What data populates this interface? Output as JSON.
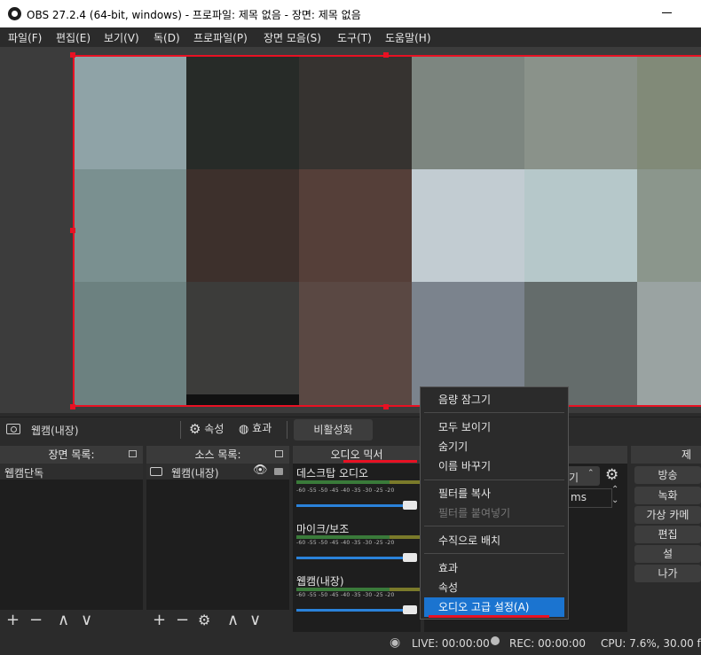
{
  "window": {
    "title": "OBS 27.2.4 (64-bit, windows) - 프로파일: 제목 없음 - 장면: 제목 없음"
  },
  "menubar": [
    {
      "label": "파일(F)",
      "name": "menu-file"
    },
    {
      "label": "편집(E)",
      "name": "menu-edit"
    },
    {
      "label": "보기(V)",
      "name": "menu-view"
    },
    {
      "label": "독(D)",
      "name": "menu-dock"
    },
    {
      "label": "프로파일(P)",
      "name": "menu-profile"
    },
    {
      "label": "장면 모음(S)",
      "name": "menu-scene-collection"
    },
    {
      "label": "도구(T)",
      "name": "menu-tools"
    },
    {
      "label": "도움말(H)",
      "name": "menu-help"
    }
  ],
  "source_toolbar": {
    "source_name": "웹캠(내장)",
    "properties": "속성",
    "filters": "효과",
    "deactivate": "비활성화"
  },
  "scenes": {
    "title": "장면 목록:",
    "items": [
      "웹캠단독"
    ]
  },
  "sources": {
    "title": "소스 목록:",
    "items": [
      "웹캠(내장)"
    ]
  },
  "mixer": {
    "title": "오디오 믹서",
    "scale_ticks": "-60  -55  -50  -45  -40  -35  -30  -25  -20",
    "channels": [
      {
        "name": "데스크탑 오디오"
      },
      {
        "name": "마이크/보조"
      },
      {
        "name": "웹캠(내장)"
      }
    ]
  },
  "transitions": {
    "partial_select": "기",
    "partial_duration_unit": "ms"
  },
  "controls": {
    "title": "제어",
    "buttons": [
      "방송",
      "녹화",
      "가상 카메",
      "편집",
      "설",
      "나가"
    ]
  },
  "context_menu": {
    "items": [
      {
        "label": "음량 잠그기",
        "state": "normal"
      },
      {
        "label": "모두 보이기",
        "state": "normal"
      },
      {
        "label": "숨기기",
        "state": "normal"
      },
      {
        "label": "이름 바꾸기",
        "state": "normal"
      },
      {
        "label": "필터를 복사",
        "state": "normal"
      },
      {
        "label": "필터를 붙여넣기",
        "state": "disabled"
      },
      {
        "label": "수직으로 배치",
        "state": "normal"
      },
      {
        "label": "효과",
        "state": "normal"
      },
      {
        "label": "속성",
        "state": "normal"
      },
      {
        "label": "오디오 고급 설정(A)",
        "state": "highlighted"
      }
    ]
  },
  "status": {
    "live": "LIVE: 00:00:00",
    "rec": "REC: 00:00:00",
    "cpu": "CPU: 7.6%, 30.00 fps"
  },
  "colors": {
    "accent": "#1b74d0",
    "selection_red": "#e81123"
  }
}
